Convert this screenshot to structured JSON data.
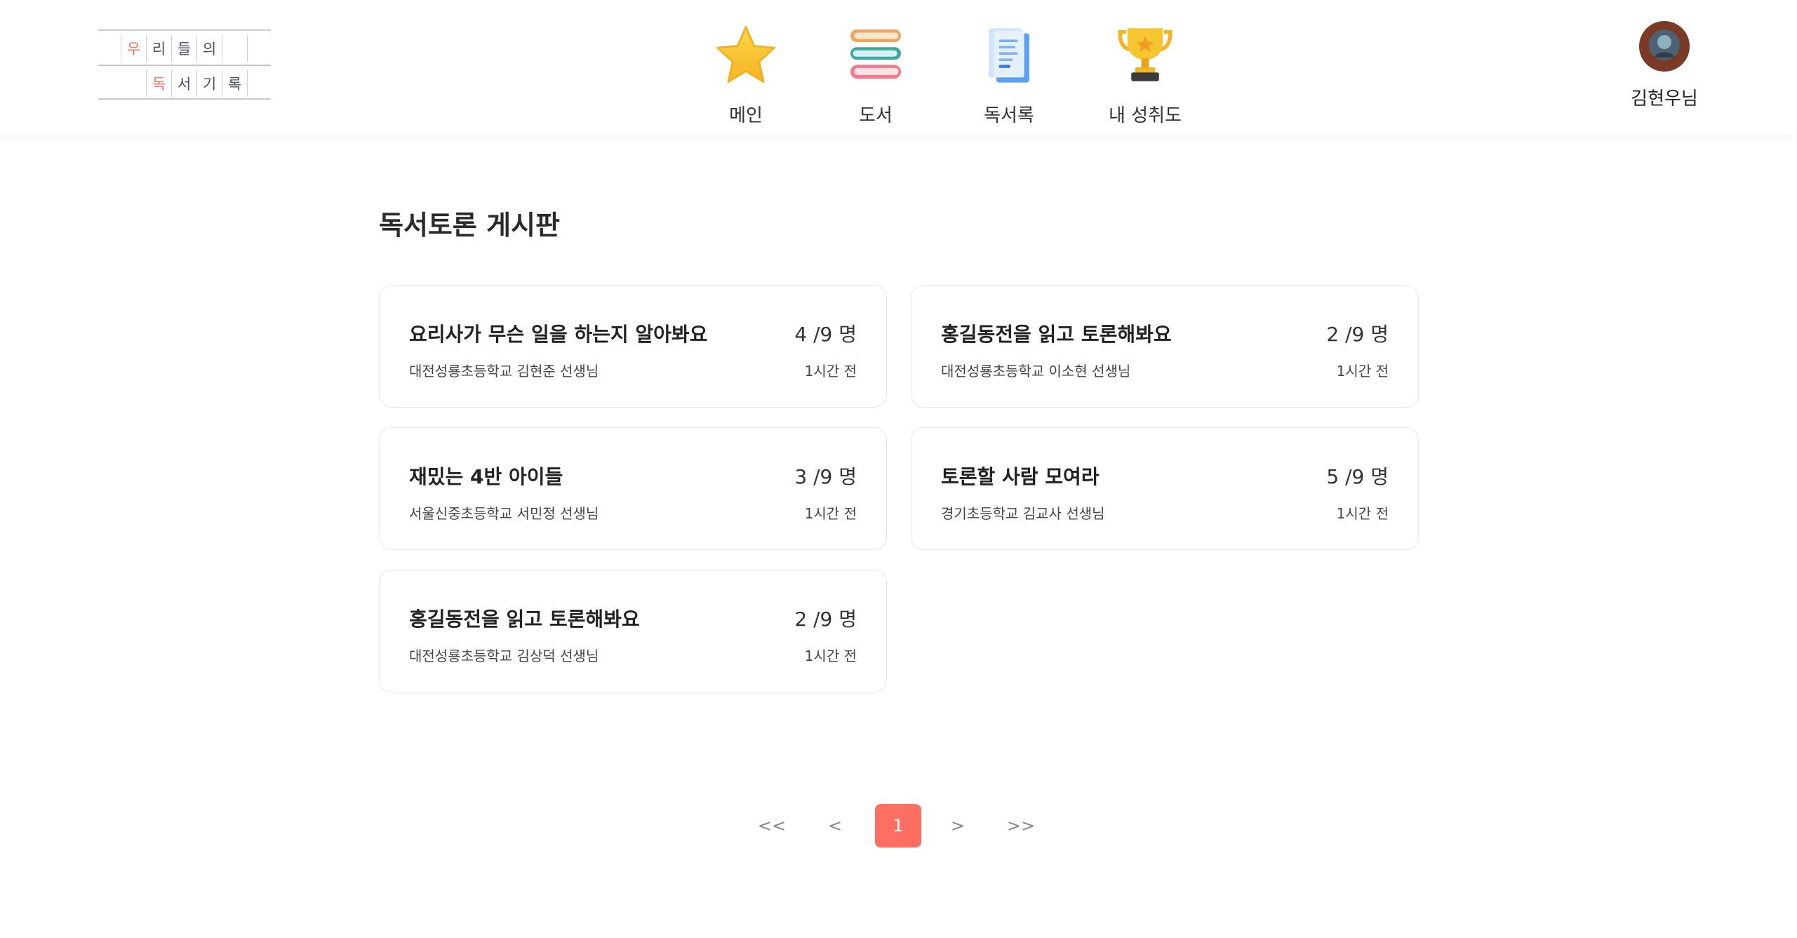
{
  "logo": {
    "row1": [
      "우",
      "리",
      "들",
      "의"
    ],
    "row2": [
      "독",
      "서",
      "기",
      "록"
    ],
    "accent_color": "#ff6f61"
  },
  "nav": {
    "items": [
      {
        "label": "메인",
        "icon": "star-icon"
      },
      {
        "label": "도서",
        "icon": "book-stack-icon"
      },
      {
        "label": "독서록",
        "icon": "document-icon"
      },
      {
        "label": "내 성취도",
        "icon": "trophy-icon"
      }
    ]
  },
  "user": {
    "name": "김현우님"
  },
  "page": {
    "title": "독서토론 게시판"
  },
  "posts": [
    {
      "title": "요리사가 무슨 일을 하는지 알아봐요",
      "count": "4 /9 명",
      "author": "대전성룡초등학교 김현준 선생님",
      "time": "1시간 전"
    },
    {
      "title": "홍길동전을 읽고 토론해봐요",
      "count": "2 /9 명",
      "author": "대전성룡초등학교 이소현 선생님",
      "time": "1시간 전"
    },
    {
      "title": "재밌는 4반 아이들",
      "count": "3 /9 명",
      "author": "서울신중초등학교 서민정 선생님",
      "time": "1시간 전"
    },
    {
      "title": "토론할 사람 모여라",
      "count": "5 /9 명",
      "author": "경기초등학교 김교사 선생님",
      "time": "1시간 전"
    },
    {
      "title": "홍길동전을 읽고 토론해봐요",
      "count": "2 /9 명",
      "author": "대전성룡초등학교 김상덕 선생님",
      "time": "1시간 전"
    }
  ],
  "pagination": {
    "first": "<<",
    "prev": "<",
    "current": "1",
    "next": ">",
    "last": ">>",
    "active_color": "#ff6f61"
  }
}
